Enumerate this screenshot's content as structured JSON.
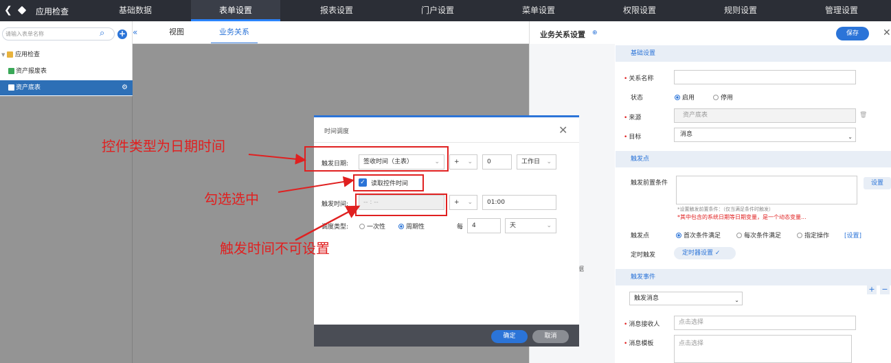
{
  "topnav": {
    "app_title": "应用检查",
    "items": [
      "基础数据",
      "表单设置",
      "报表设置",
      "门户设置",
      "菜单设置",
      "权限设置",
      "规则设置",
      "管理设置"
    ],
    "active_index": 1
  },
  "sidebar": {
    "search_placeholder": "请输入表单名称",
    "tree": [
      {
        "label": "应用检查",
        "type": "folder"
      },
      {
        "label": "资产报废表",
        "type": "form"
      },
      {
        "label": "资产底表",
        "type": "form",
        "selected": true
      }
    ]
  },
  "tabs": {
    "view": "视图",
    "biz": "业务关系"
  },
  "right_panel": {
    "title": "业务关系设置",
    "save": "保存",
    "section_basic": "基础设置",
    "name_label": "关系名称",
    "status_label": "状态",
    "status_on": "启用",
    "status_off": "停用",
    "source_label": "来源",
    "source_value": "资产底表",
    "target_label": "目标",
    "target_value": "消息",
    "section_trigger": "触发点",
    "precond_label": "触发前置条件",
    "set_button": "设置",
    "precond_hint": "*设置触发前置条件：（仅当满足条件时触发）",
    "precond_warn": "*其中包含的系统日期等日期变量，是一个动态变量...",
    "trigger_label": "触发点",
    "trigger_opt1": "首次条件满足",
    "trigger_opt2": "每次条件满足",
    "trigger_opt3": "指定操作",
    "trigger_set_link": "[设置]",
    "timer_label": "定时触发",
    "timer_button": "定时器设置 ✓",
    "section_event": "触发事件",
    "event_value": "触发消息",
    "receiver_label": "消息接收人",
    "receiver_placeholder": "点击选择",
    "template_label": "消息模板",
    "template_placeholder": "点击选择",
    "bg_text": "据"
  },
  "dialog": {
    "title": "时间调度",
    "trigger_date_label": "触发日期:",
    "trigger_date_value": "签收时间（主表）",
    "plus": "+",
    "offset_value": "0",
    "unit_value": "工作日",
    "checkbox_label": "读取控件时间",
    "trigger_time_label": "触发时间:",
    "trigger_time_value": "-- : --",
    "time_offset_value": "01:00",
    "schedule_label": "调度类型:",
    "once": "一次性",
    "periodic": "周期性",
    "every": "每",
    "every_value": "4",
    "every_unit": "天",
    "ok": "确定",
    "cancel": "取消"
  },
  "annotations": {
    "a1": "控件类型为日期时间",
    "a2": "勾选选中",
    "a3": "触发时间不可设置"
  },
  "colors": {
    "accent": "#2b74d8",
    "nav_bg": "#2b2e36",
    "annotation": "#e02020"
  }
}
